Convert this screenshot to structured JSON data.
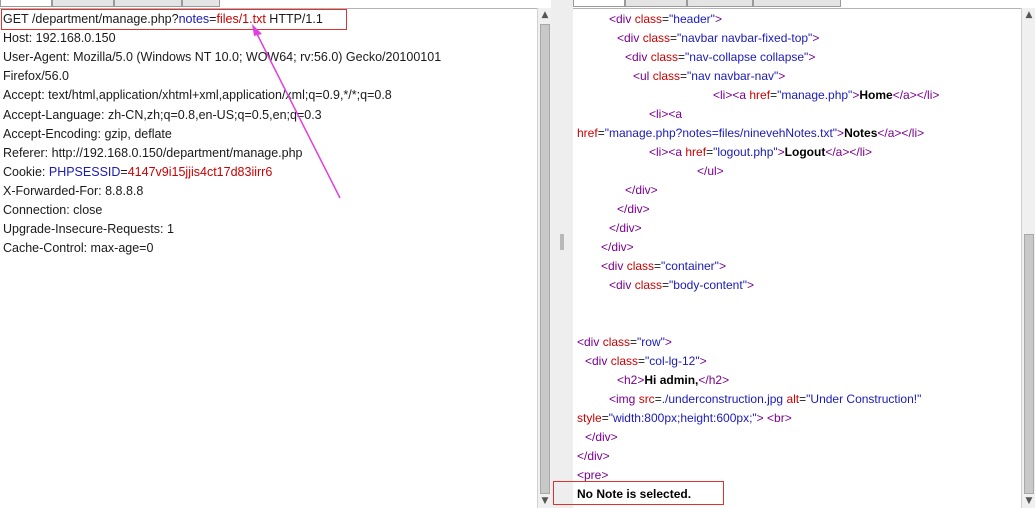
{
  "request": {
    "lines": [
      {
        "id": "req-line-1",
        "parts": [
          {
            "t": "GET /department/manage.php?",
            "c": ""
          },
          {
            "t": "notes",
            "c": "hl-key"
          },
          {
            "t": "=",
            "c": ""
          },
          {
            "t": "files/1.txt",
            "c": "hl-val"
          },
          {
            "t": " HTTP/1.1",
            "c": ""
          }
        ]
      },
      {
        "id": "req-line-2",
        "parts": [
          {
            "t": "Host: 192.168.0.150",
            "c": ""
          }
        ]
      },
      {
        "id": "req-line-3",
        "parts": [
          {
            "t": "User-Agent: Mozilla/5.0 (Windows NT 10.0; WOW64; rv:56.0) Gecko/20100101",
            "c": ""
          }
        ]
      },
      {
        "id": "req-line-4",
        "parts": [
          {
            "t": "Firefox/56.0",
            "c": ""
          }
        ]
      },
      {
        "id": "req-line-5",
        "parts": [
          {
            "t": "Accept: text/html,application/xhtml+xml,application/xml;q=0.9,*/*;q=0.8",
            "c": ""
          }
        ]
      },
      {
        "id": "req-line-6",
        "parts": [
          {
            "t": "Accept-Language: zh-CN,zh;q=0.8,en-US;q=0.5,en;q=0.3",
            "c": ""
          }
        ]
      },
      {
        "id": "req-line-7",
        "parts": [
          {
            "t": "Accept-Encoding: gzip, deflate",
            "c": ""
          }
        ]
      },
      {
        "id": "req-line-8",
        "parts": [
          {
            "t": "Referer: http://192.168.0.150/department/manage.php",
            "c": ""
          }
        ]
      },
      {
        "id": "req-line-9",
        "parts": [
          {
            "t": "Cookie: ",
            "c": ""
          },
          {
            "t": "PHPSESSID",
            "c": "hl-key"
          },
          {
            "t": "=",
            "c": ""
          },
          {
            "t": "4147v9i15jjis4ct17d83iirr6",
            "c": "hl-val"
          }
        ]
      },
      {
        "id": "req-line-10",
        "parts": [
          {
            "t": "X-Forwarded-For: 8.8.8.8",
            "c": ""
          }
        ]
      },
      {
        "id": "req-line-11",
        "parts": [
          {
            "t": "Connection: close",
            "c": ""
          }
        ]
      },
      {
        "id": "req-line-12",
        "parts": [
          {
            "t": "Upgrade-Insecure-Requests: 1",
            "c": ""
          }
        ]
      },
      {
        "id": "req-line-13",
        "parts": [
          {
            "t": "Cache-Control: max-age=0",
            "c": ""
          }
        ]
      }
    ]
  },
  "response": {
    "lines": [
      {
        "id": "res-line-1",
        "parts": [
          {
            "t": "<div ",
            "c": "tag"
          },
          {
            "t": "class",
            "c": "attr"
          },
          {
            "t": "=",
            "c": ""
          },
          {
            "t": "\"header\"",
            "c": "val"
          },
          {
            "t": ">",
            "c": "tag"
          }
        ]
      },
      {
        "id": "res-line-2",
        "parts": [
          {
            "t": "<div ",
            "c": "tag"
          },
          {
            "t": "class",
            "c": "attr"
          },
          {
            "t": "=",
            "c": ""
          },
          {
            "t": "\"navbar navbar-fixed-top\"",
            "c": "val"
          },
          {
            "t": ">",
            "c": "tag"
          }
        ]
      },
      {
        "id": "res-line-3",
        "parts": [
          {
            "t": "<div ",
            "c": "tag"
          },
          {
            "t": "class",
            "c": "attr"
          },
          {
            "t": "=",
            "c": ""
          },
          {
            "t": "\"nav-collapse collapse\"",
            "c": "val"
          },
          {
            "t": ">",
            "c": "tag"
          }
        ]
      },
      {
        "id": "res-line-4",
        "parts": [
          {
            "t": "<ul ",
            "c": "tag"
          },
          {
            "t": "class",
            "c": "attr"
          },
          {
            "t": "=",
            "c": ""
          },
          {
            "t": "\"nav navbar-nav\"",
            "c": "val"
          },
          {
            "t": ">",
            "c": "tag"
          }
        ]
      },
      {
        "id": "res-line-5",
        "parts": [
          {
            "t": "<li>",
            "c": "tag"
          },
          {
            "t": "<a ",
            "c": "tag"
          },
          {
            "t": "href",
            "c": "attr"
          },
          {
            "t": "=",
            "c": ""
          },
          {
            "t": "\"manage.php\"",
            "c": "val"
          },
          {
            "t": ">",
            "c": "tag"
          },
          {
            "t": "Home",
            "c": "b"
          },
          {
            "t": "</a></li>",
            "c": "tag"
          }
        ]
      },
      {
        "id": "res-line-6",
        "parts": [
          {
            "t": "<li>",
            "c": "tag"
          },
          {
            "t": "<a",
            "c": "tag"
          }
        ]
      },
      {
        "id": "res-line-7",
        "parts": [
          {
            "t": "href",
            "c": "attr"
          },
          {
            "t": "=",
            "c": ""
          },
          {
            "t": "\"manage.php?notes=files/ninevehNotes.txt\"",
            "c": "val"
          },
          {
            "t": ">",
            "c": "tag"
          },
          {
            "t": "Notes",
            "c": "b"
          },
          {
            "t": "</a></li>",
            "c": "tag"
          }
        ]
      },
      {
        "id": "res-line-8",
        "parts": [
          {
            "t": "<li>",
            "c": "tag"
          },
          {
            "t": "<a ",
            "c": "tag"
          },
          {
            "t": "href",
            "c": "attr"
          },
          {
            "t": "=",
            "c": ""
          },
          {
            "t": "\"logout.php\"",
            "c": "val"
          },
          {
            "t": ">",
            "c": "tag"
          },
          {
            "t": "Logout",
            "c": "b"
          },
          {
            "t": "</a></li>",
            "c": "tag"
          }
        ]
      },
      {
        "id": "res-line-9",
        "parts": [
          {
            "t": "</ul>",
            "c": "tag"
          }
        ]
      },
      {
        "id": "res-line-10",
        "parts": [
          {
            "t": "</div>",
            "c": "tag"
          }
        ]
      },
      {
        "id": "res-line-11",
        "parts": [
          {
            "t": "</div>",
            "c": "tag"
          }
        ]
      },
      {
        "id": "res-line-12",
        "parts": [
          {
            "t": "</div>",
            "c": "tag"
          }
        ]
      },
      {
        "id": "res-line-13",
        "parts": [
          {
            "t": "</div>",
            "c": "tag"
          }
        ]
      },
      {
        "id": "res-line-14",
        "parts": [
          {
            "t": "<div ",
            "c": "tag"
          },
          {
            "t": "class",
            "c": "attr"
          },
          {
            "t": "=",
            "c": ""
          },
          {
            "t": "\"container\"",
            "c": "val"
          },
          {
            "t": ">",
            "c": "tag"
          }
        ]
      },
      {
        "id": "res-line-15",
        "parts": [
          {
            "t": "<div ",
            "c": "tag"
          },
          {
            "t": "class",
            "c": "attr"
          },
          {
            "t": "=",
            "c": ""
          },
          {
            "t": "\"body-content\"",
            "c": "val"
          },
          {
            "t": ">",
            "c": "tag"
          }
        ]
      },
      {
        "id": "res-line-16",
        "parts": [
          {
            "t": "<div ",
            "c": "tag"
          },
          {
            "t": "class",
            "c": "attr"
          },
          {
            "t": "=",
            "c": ""
          },
          {
            "t": "\"row\"",
            "c": "val"
          },
          {
            "t": ">",
            "c": "tag"
          }
        ]
      },
      {
        "id": "res-line-17",
        "parts": [
          {
            "t": "<div ",
            "c": "tag"
          },
          {
            "t": "class",
            "c": "attr"
          },
          {
            "t": "=",
            "c": ""
          },
          {
            "t": "\"col-lg-12\"",
            "c": "val"
          },
          {
            "t": ">",
            "c": "tag"
          }
        ]
      },
      {
        "id": "res-line-18",
        "parts": [
          {
            "t": "<h2>",
            "c": "tag"
          },
          {
            "t": "Hi admin,",
            "c": "b"
          },
          {
            "t": "</h2>",
            "c": "tag"
          }
        ]
      },
      {
        "id": "res-line-19",
        "parts": [
          {
            "t": "<img ",
            "c": "tag"
          },
          {
            "t": "src",
            "c": "attr"
          },
          {
            "t": "=",
            "c": ""
          },
          {
            "t": "./underconstruction.jpg",
            "c": "val"
          },
          {
            "t": " alt",
            "c": "attr"
          },
          {
            "t": "=",
            "c": ""
          },
          {
            "t": "\"Under Construction!\"",
            "c": "val"
          }
        ]
      },
      {
        "id": "res-line-20",
        "parts": [
          {
            "t": "style",
            "c": "attr"
          },
          {
            "t": "=",
            "c": ""
          },
          {
            "t": "\"width:800px;height:600px;\"",
            "c": "val"
          },
          {
            "t": "> <br>",
            "c": "tag"
          }
        ]
      },
      {
        "id": "res-line-21",
        "parts": [
          {
            "t": "</div>",
            "c": "tag"
          }
        ]
      },
      {
        "id": "res-line-22",
        "parts": [
          {
            "t": "</div>",
            "c": "tag"
          }
        ]
      },
      {
        "id": "res-line-23",
        "parts": [
          {
            "t": "<pre>",
            "c": "tag"
          }
        ]
      },
      {
        "id": "res-line-24",
        "parts": [
          {
            "t": "No Note is selected.",
            "c": "b"
          }
        ]
      }
    ]
  },
  "colors": {
    "highlight_box": "#e03030",
    "arrow": "#e040e0",
    "tag": "#7a0090",
    "attribute": "#cc0000",
    "attr_value": "#1a1ab8"
  },
  "scrollbar_position": 0.0
}
